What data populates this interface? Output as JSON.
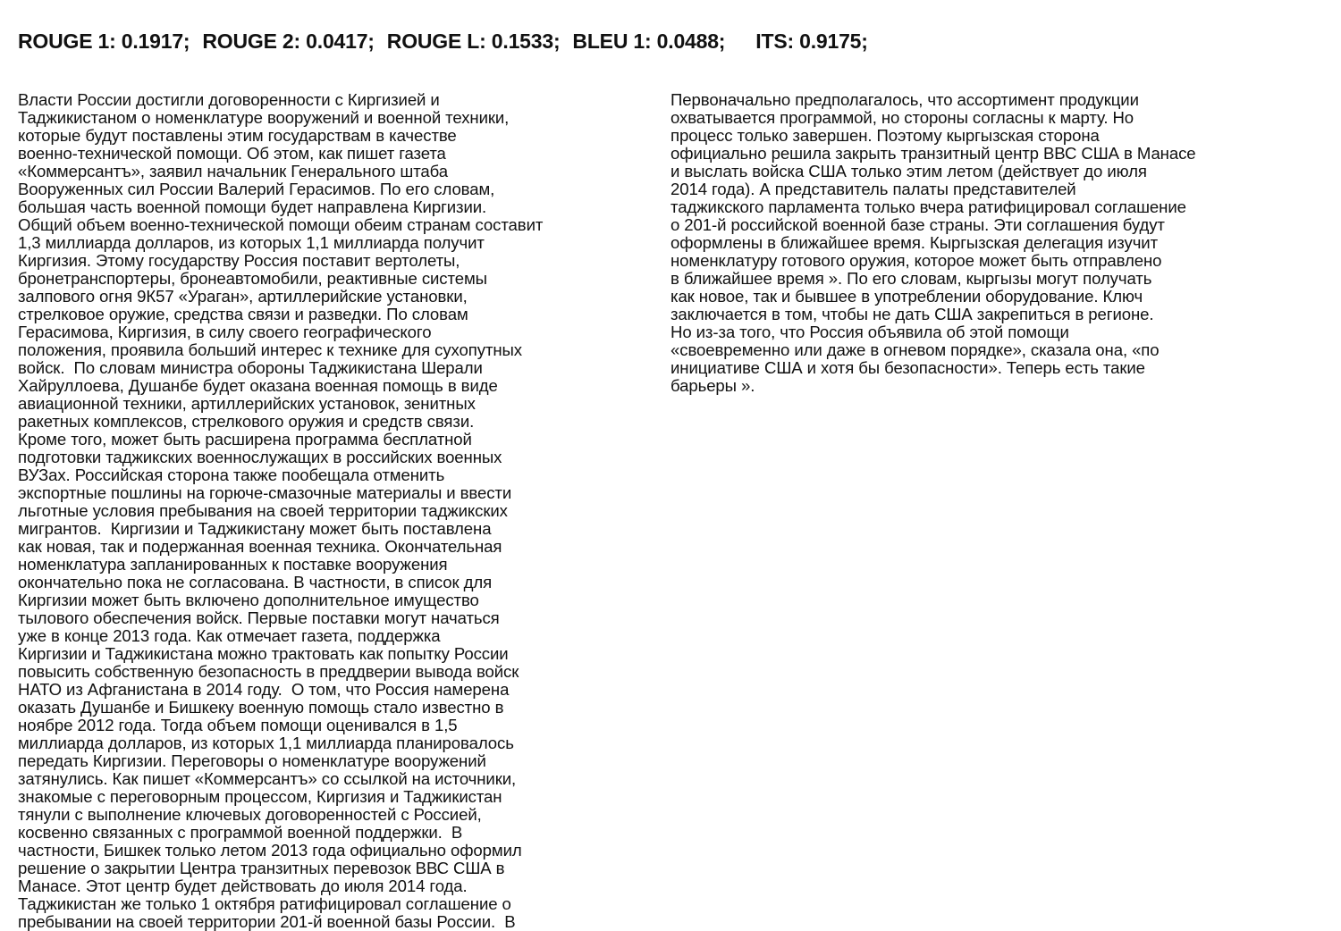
{
  "metrics": {
    "rouge1": "ROUGE 1: 0.1917;",
    "rouge2": "ROUGE 2: 0.0417;",
    "rougeL": "ROUGE L: 0.1533;",
    "bleu1": "BLEU 1: 0.0488;",
    "its": "ITS: 0.9175;"
  },
  "left_column": {
    "lines": [
      "Власти России достигли договоренности с Киргизией и",
      "Таджикистаном о номенклатуре вооружений и военной техники,",
      "которые будут поставлены этим государствам в качестве",
      "военно-технической помощи. Об этом, как пишет газета",
      "«Коммерсантъ», заявил начальник Генерального штаба",
      "Вооруженных сил России Валерий Герасимов. По его словам,",
      "большая часть военной помощи будет направлена Киргизии.",
      "Общий объем военно-технической помощи обеим странам составит",
      "1,3 миллиарда долларов, из которых 1,1 миллиарда получит",
      "Киргизия. Этому государству Россия поставит вертолеты,",
      "бронетранспортеры, бронеавтомобили, реактивные системы",
      "залпового огня 9К57 «Ураган», артиллерийские установки,",
      "стрелковое оружие, средства связи и разведки. По словам",
      "Герасимова, Киргизия, в силу своего географического",
      "положения, проявила больший интерес к технике для сухопутных",
      "войск.  По словам министра обороны Таджикистана Шерали",
      "Хайруллоева, Душанбе будет оказана военная помощь в виде",
      "авиационной техники, артиллерийских установок, зенитных",
      "ракетных комплексов, стрелкового оружия и средств связи.",
      "Кроме того, может быть расширена программа бесплатной",
      "подготовки таджикских военнослужащих в российских военных",
      "ВУЗах. Российская сторона также пообещала отменить",
      "экспортные пошлины на горюче-смазочные материалы и ввести",
      "льготные условия пребывания на своей территории таджикских",
      "мигрантов.  Киргизии и Таджикистану может быть поставлена",
      "как новая, так и подержанная военная техника. Окончательная",
      "номенклатура запланированных к поставке вооружения",
      "окончательно пока не согласована. В частности, в список для",
      "Киргизии может быть включено дополнительное имущество",
      "тылового обеспечения войск. Первые поставки могут начаться",
      "уже в конце 2013 года. Как отмечает газета, поддержка",
      "Киргизии и Таджикистана можно трактовать как попытку России",
      "повысить собственную безопасность в преддверии вывода войск",
      "НАТО из Афганистана в 2014 году.  О том, что Россия намерена",
      "оказать Душанбе и Бишкеку военную помощь стало известно в",
      "ноябре 2012 года. Тогда объем помощи оценивался в 1,5",
      "миллиарда долларов, из которых 1,1 миллиарда планировалось",
      "передать Киргизии. Переговоры о номенклатуре вооружений",
      "затянулись. Как пишет «Коммерсантъ» со ссылкой на источники,",
      "знакомые с переговорным процессом, Киргизия и Таджикистан",
      "тянули с выполнение ключевых договоренностей с Россией,",
      "косвенно связанных с программой военной поддержки.  В",
      "частности, Бишкек только летом 2013 года официально оформил",
      "решение о закрытии Центра транзитных перевозок ВВС США в",
      "Манасе. Этот центр будет действовать до июля 2014 года.",
      "Таджикистан же только 1 октября ратифицировал соглашение о",
      "пребывании на своей территории 201-й военной базы России.  В"
    ]
  },
  "right_column": {
    "lines": [
      "Первоначально предполагалось, что ассортимент продукции",
      "охватывается программой, но стороны согласны к марту. Но",
      "процесс только завершен. Поэтому кыргызская сторона",
      "официально решила закрыть транзитный центр ВВС США в Манасе",
      "и выслать войска США только этим летом (действует до июля",
      "2014 года). А представитель палаты представителей",
      "таджикского парламента только вчера ратифицировал соглашение",
      "о 201-й российской военной базе страны. Эти соглашения будут",
      "оформлены в ближайшее время. Кыргызская делегация изучит",
      "номенклатуру готового оружия, которое может быть отправлено",
      "в ближайшее время ». По его словам, кыргызы могут получать",
      "как новое, так и бывшее в употреблении оборудование. Ключ",
      "заключается в том, чтобы не дать США закрепиться в регионе.",
      "Но из-за того, что Россия объявила об этой помощи",
      "«своевременно или даже в огневом порядке», сказала она, «по",
      "инициативе США и хотя бы безопасности». Теперь есть такие",
      "барьеры »."
    ]
  }
}
